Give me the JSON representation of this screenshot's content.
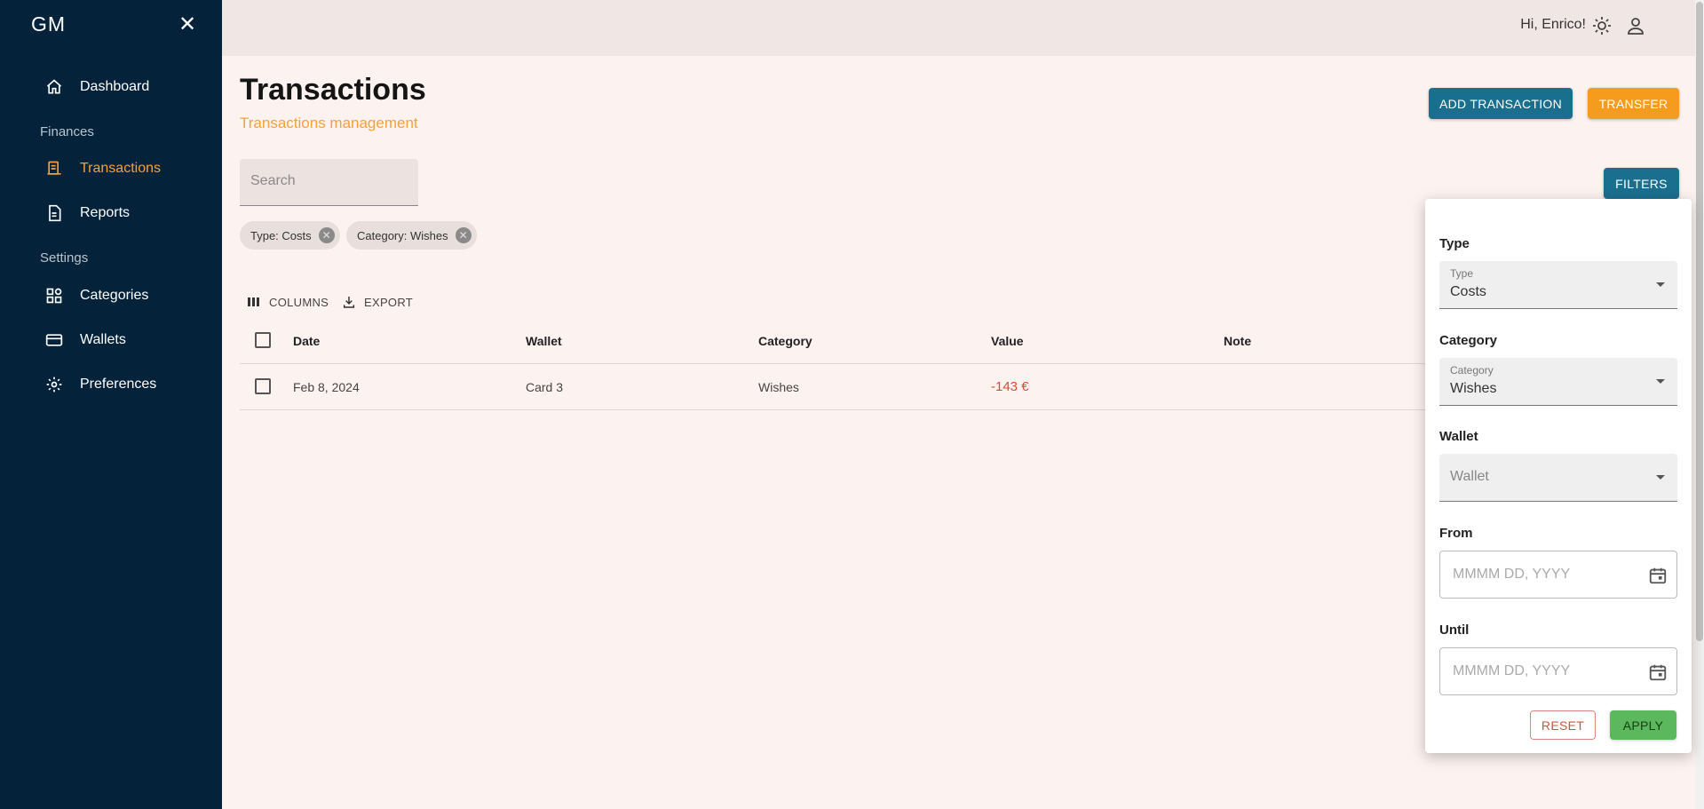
{
  "app": {
    "logo": "GM"
  },
  "sidebar": {
    "items": [
      {
        "label": "Dashboard",
        "icon": "home-icon"
      },
      {
        "label": "Transactions",
        "icon": "receipt-icon",
        "active": true
      },
      {
        "label": "Reports",
        "icon": "document-icon"
      },
      {
        "label": "Categories",
        "icon": "category-icon"
      },
      {
        "label": "Wallets",
        "icon": "wallet-icon"
      },
      {
        "label": "Preferences",
        "icon": "gear-icon"
      }
    ],
    "sections": {
      "finances": "Finances",
      "settings": "Settings"
    }
  },
  "header": {
    "greeting": "Hi, Enrico!"
  },
  "page": {
    "title": "Transactions",
    "subtitle": "Transactions management"
  },
  "actions": {
    "add": "ADD TRANSACTION",
    "transfer": "TRANSFER",
    "filters": "FILTERS"
  },
  "search": {
    "placeholder": "Search"
  },
  "chips": [
    "Type: Costs",
    "Category: Wishes"
  ],
  "toolbar": {
    "columns": "COLUMNS",
    "export": "EXPORT"
  },
  "table": {
    "columns": [
      "Date",
      "Wallet",
      "Category",
      "Value",
      "Note"
    ],
    "rows": [
      {
        "date": "Feb 8, 2024",
        "wallet": "Card 3",
        "category": "Wishes",
        "value": "-143 €",
        "note": ""
      }
    ]
  },
  "filters": {
    "type": {
      "label": "Type",
      "field_label": "Type",
      "value": "Costs"
    },
    "category": {
      "label": "Category",
      "field_label": "Category",
      "value": "Wishes"
    },
    "wallet": {
      "label": "Wallet",
      "placeholder": "Wallet"
    },
    "from": {
      "label": "From",
      "placeholder": "MMMM DD, YYYY"
    },
    "until": {
      "label": "Until",
      "placeholder": "MMMM DD, YYYY"
    },
    "reset": "RESET",
    "apply": "APPLY"
  },
  "colors": {
    "sidebar": "#04233a",
    "accent": "#f5a13a",
    "primary": "#1a6f8e",
    "apply": "#5cb85c",
    "negative": "#d84a3a"
  }
}
